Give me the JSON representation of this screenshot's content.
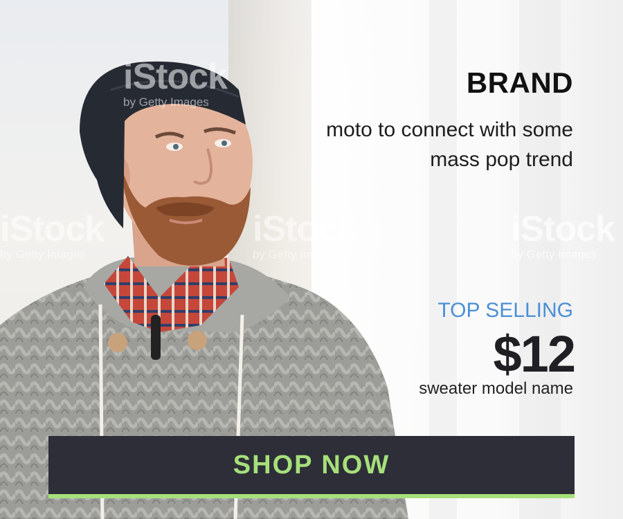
{
  "ad": {
    "brand": "BRAND",
    "tagline": "moto to connect with some mass pop trend",
    "top_selling": "TOP SELLING",
    "price": "$12",
    "model_name": "sweater model name",
    "cta_label": "SHOP NOW"
  },
  "watermark": {
    "main": "iStock",
    "sub": "by Getty Images"
  },
  "colors": {
    "accent_blue": "#4a8fd6",
    "cta_background": "#2d2e38",
    "cta_text": "#a6e07a",
    "heading": "#111111"
  },
  "icons": {
    "photo": "bearded-man-photo"
  }
}
